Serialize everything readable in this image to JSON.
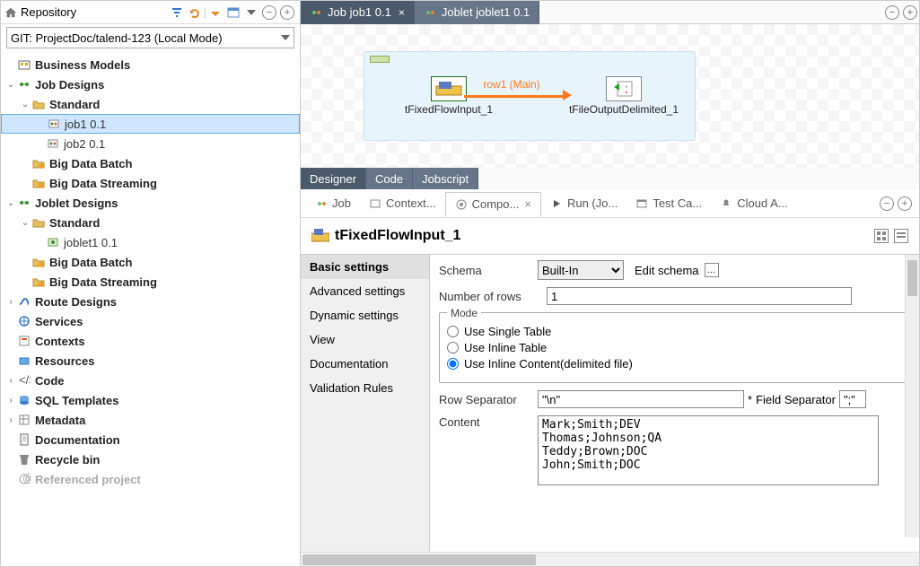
{
  "repo": {
    "title": "Repository",
    "combo": "GIT: ProjectDoc/talend-123   (Local Mode)"
  },
  "tree": [
    {
      "indent": 0,
      "toggle": "",
      "bold": true,
      "label": "Business Models",
      "icon": "biz"
    },
    {
      "indent": 0,
      "toggle": "v",
      "bold": true,
      "label": "Job Designs",
      "icon": "jobs"
    },
    {
      "indent": 1,
      "toggle": "v",
      "bold": true,
      "label": "Standard",
      "icon": "folder"
    },
    {
      "indent": 2,
      "toggle": "",
      "bold": false,
      "label": "job1 0.1",
      "icon": "job",
      "selected": true
    },
    {
      "indent": 2,
      "toggle": "",
      "bold": false,
      "label": "job2 0.1",
      "icon": "job"
    },
    {
      "indent": 1,
      "toggle": "",
      "bold": true,
      "label": "Big Data Batch",
      "icon": "folderh"
    },
    {
      "indent": 1,
      "toggle": "",
      "bold": true,
      "label": "Big Data Streaming",
      "icon": "folderh"
    },
    {
      "indent": 0,
      "toggle": "v",
      "bold": true,
      "label": "Joblet Designs",
      "icon": "jobs"
    },
    {
      "indent": 1,
      "toggle": "v",
      "bold": true,
      "label": "Standard",
      "icon": "folder"
    },
    {
      "indent": 2,
      "toggle": "",
      "bold": false,
      "label": "joblet1 0.1",
      "icon": "joblet"
    },
    {
      "indent": 1,
      "toggle": "",
      "bold": true,
      "label": "Big Data Batch",
      "icon": "folderh"
    },
    {
      "indent": 1,
      "toggle": "",
      "bold": true,
      "label": "Big Data Streaming",
      "icon": "folderh"
    },
    {
      "indent": 0,
      "toggle": ">",
      "bold": true,
      "label": "Route Designs",
      "icon": "routes"
    },
    {
      "indent": 0,
      "toggle": "",
      "bold": true,
      "label": "Services",
      "icon": "services"
    },
    {
      "indent": 0,
      "toggle": "",
      "bold": true,
      "label": "Contexts",
      "icon": "contexts"
    },
    {
      "indent": 0,
      "toggle": "",
      "bold": true,
      "label": "Resources",
      "icon": "resources"
    },
    {
      "indent": 0,
      "toggle": ">",
      "bold": true,
      "label": "Code",
      "icon": "code"
    },
    {
      "indent": 0,
      "toggle": ">",
      "bold": true,
      "label": "SQL Templates",
      "icon": "sql"
    },
    {
      "indent": 0,
      "toggle": ">",
      "bold": true,
      "label": "Metadata",
      "icon": "meta"
    },
    {
      "indent": 0,
      "toggle": "",
      "bold": true,
      "label": "Documentation",
      "icon": "doc"
    },
    {
      "indent": 0,
      "toggle": "",
      "bold": true,
      "label": "Recycle bin",
      "icon": "trash"
    },
    {
      "indent": 0,
      "toggle": "",
      "bold": true,
      "label": "Referenced project",
      "icon": "ref",
      "muted": true
    }
  ],
  "editorTabs": [
    {
      "label": "Job job1 0.1",
      "active": true,
      "closable": true
    },
    {
      "label": "Joblet joblet1 0.1",
      "active": false,
      "closable": false
    }
  ],
  "canvas": {
    "node1": "tFixedFlowInput_1",
    "node2": "tFileOutputDelimited_1",
    "link": "row1 (Main)"
  },
  "designerTabs": [
    "Designer",
    "Code",
    "Jobscript"
  ],
  "viewsTabs": [
    {
      "label": "Job"
    },
    {
      "label": "Context..."
    },
    {
      "label": "Compo...",
      "active": true
    },
    {
      "label": "Run (Jo..."
    },
    {
      "label": "Test Ca..."
    },
    {
      "label": "Cloud A..."
    }
  ],
  "component": {
    "title": "tFixedFlowInput_1",
    "sideTabs": [
      "Basic settings",
      "Advanced settings",
      "Dynamic settings",
      "View",
      "Documentation",
      "Validation Rules"
    ],
    "schemaLabel": "Schema",
    "schemaValue": "Built-In",
    "editSchema": "Edit schema",
    "rowsLabel": "Number of rows",
    "rowsValue": "1",
    "modeLegend": "Mode",
    "modeOptions": [
      "Use Single Table",
      "Use Inline Table",
      "Use Inline Content(delimited file)"
    ],
    "modeSelected": 2,
    "rowSepLabel": "Row Separator",
    "rowSepValue": "\"\\n\"",
    "fieldSepLabel": "Field Separator",
    "fieldSepValue": "\";\"",
    "asterisk": "*",
    "contentLabel": "Content",
    "contentValue": "Mark;Smith;DEV\nThomas;Johnson;QA\nTeddy;Brown;DOC\nJohn;Smith;DOC"
  }
}
